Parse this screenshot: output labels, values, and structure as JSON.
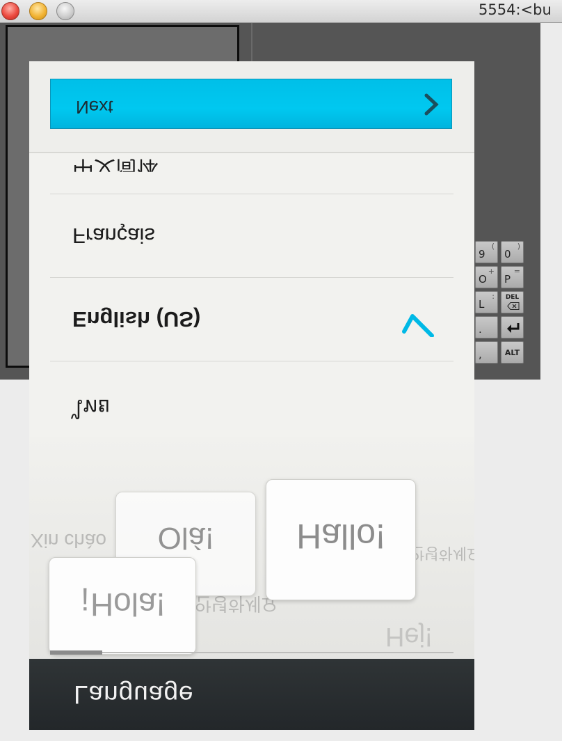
{
  "window": {
    "title": "5554:<bu",
    "traffic_lights": [
      "close-button",
      "minimize-button",
      "zoom-button"
    ]
  },
  "keypad": {
    "keys": [
      {
        "main": "9",
        "sub": "("
      },
      {
        "main": "0",
        "sub": ")"
      },
      {
        "main": "O",
        "sub": "+"
      },
      {
        "main": "P",
        "sub": "="
      },
      {
        "main": "L",
        "sub": ":"
      },
      {
        "main": "DEL",
        "sub": ""
      },
      {
        "main": ".",
        "sub": ""
      },
      {
        "main": "enter-icon",
        "sub": ""
      },
      {
        "main": ",",
        "sub": ""
      },
      {
        "main": "ALT",
        "sub": ""
      }
    ]
  },
  "phone": {
    "next_button": {
      "label": "Next",
      "icon": "chevron-right-icon"
    },
    "languages": [
      {
        "label": "中文简体",
        "selected": false
      },
      {
        "label": "Français",
        "selected": false
      },
      {
        "label": "English (US)",
        "selected": true
      },
      {
        "label": "ไทย",
        "selected": false
      }
    ],
    "bubbles": {
      "hallo": "Hallo!",
      "hola": "¡Hola!",
      "ola": "Olá!",
      "xin_chao": "Xin chào",
      "hej": "Hej!",
      "annyeong": "안녕하세요"
    },
    "progress_fraction": 0.13,
    "bottom_title": "Language"
  },
  "colors": {
    "accent": "#00c4ee",
    "check": "#00b9e6",
    "bottom_bar": "#2a2e30"
  }
}
